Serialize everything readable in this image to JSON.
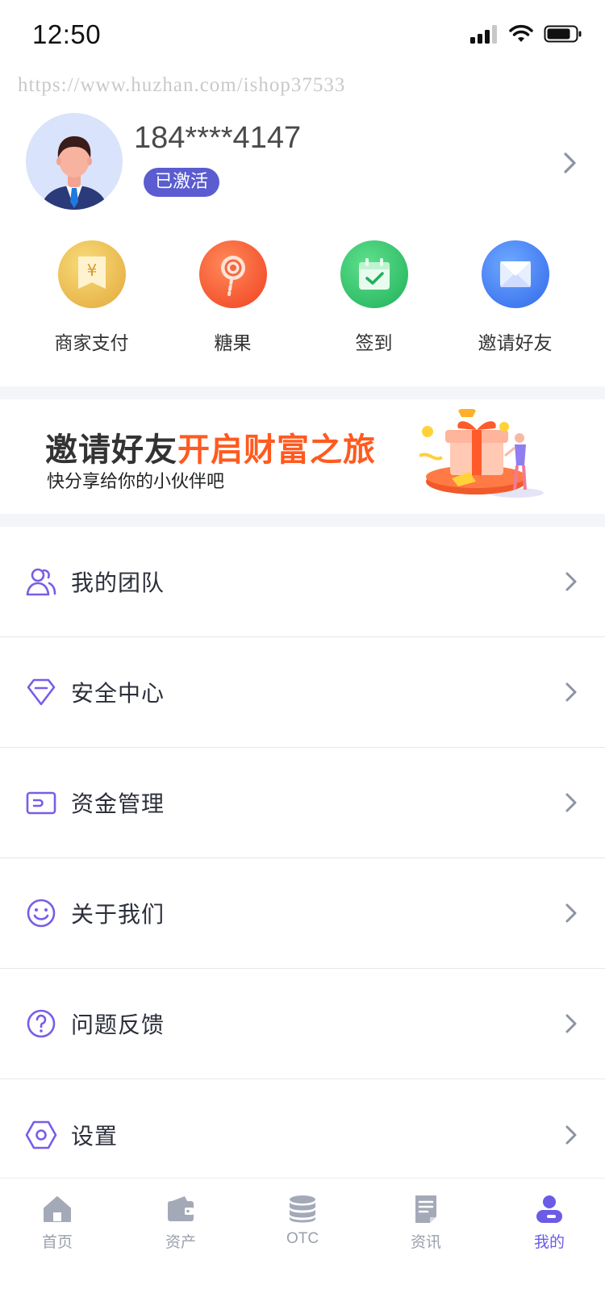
{
  "status": {
    "time": "12:50"
  },
  "watermark": "https://www.huzhan.com/ishop37533",
  "profile": {
    "phone": "184****4147",
    "badge": "已激活"
  },
  "quick_actions": [
    {
      "label": "商家支付",
      "icon": "merchant-pay-icon"
    },
    {
      "label": "糖果",
      "icon": "candy-icon"
    },
    {
      "label": "签到",
      "icon": "checkin-calendar-icon"
    },
    {
      "label": "邀请好友",
      "icon": "invite-envelope-icon"
    }
  ],
  "banner": {
    "title_part1": "邀请好友",
    "title_part2": "开启财富之旅",
    "subtitle": "快分享给你的小伙伴吧"
  },
  "menu": [
    {
      "label": "我的团队",
      "icon": "team-icon"
    },
    {
      "label": "安全中心",
      "icon": "diamond-shield-icon"
    },
    {
      "label": "资金管理",
      "icon": "wallet-icon"
    },
    {
      "label": "关于我们",
      "icon": "smile-icon"
    },
    {
      "label": "问题反馈",
      "icon": "question-icon"
    },
    {
      "label": "设置",
      "icon": "settings-hex-icon"
    }
  ],
  "tabs": [
    {
      "label": "首页",
      "icon": "home-icon"
    },
    {
      "label": "资产",
      "icon": "wallet-tab-icon"
    },
    {
      "label": "OTC",
      "icon": "coins-icon"
    },
    {
      "label": "资讯",
      "icon": "news-icon"
    },
    {
      "label": "我的",
      "icon": "user-icon",
      "active": true
    }
  ],
  "colors": {
    "accent": "#6b5be6",
    "badge": "#5a5ccf",
    "banner_highlight": "#ff5a1f",
    "tab_inactive": "#9aa0ad"
  }
}
